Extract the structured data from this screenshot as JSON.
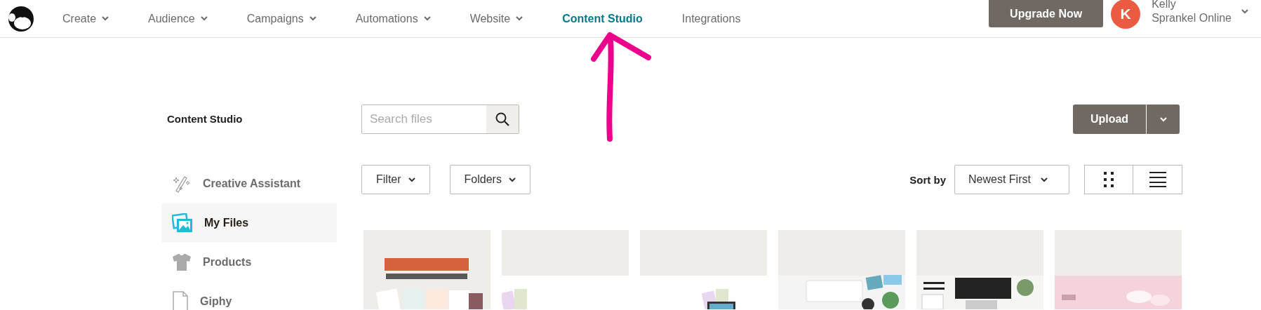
{
  "nav": {
    "items": [
      {
        "label": "Create",
        "has_menu": true,
        "selected": false
      },
      {
        "label": "Audience",
        "has_menu": true,
        "selected": false
      },
      {
        "label": "Campaigns",
        "has_menu": true,
        "selected": false
      },
      {
        "label": "Automations",
        "has_menu": true,
        "selected": false
      },
      {
        "label": "Website",
        "has_menu": true,
        "selected": false
      },
      {
        "label": "Content Studio",
        "has_menu": false,
        "selected": true
      },
      {
        "label": "Integrations",
        "has_menu": false,
        "selected": false
      }
    ],
    "upgrade_button": "Upgrade Now",
    "account": {
      "initial": "K",
      "name": [
        "Kelly",
        "Sprankel Online"
      ]
    }
  },
  "sidebar": {
    "title": "Content Studio",
    "items": [
      {
        "label": "Creative Assistant",
        "selected": false
      },
      {
        "label": "My Files",
        "selected": true
      },
      {
        "label": "Products",
        "selected": false
      },
      {
        "label": "Giphy",
        "selected": false
      }
    ]
  },
  "toolbar": {
    "search": {
      "placeholder": "Search files"
    },
    "upload_button": "Upload",
    "filters": [
      "Filter",
      "Folders"
    ],
    "sort_label": "Sort by",
    "sort_value": "Newest First"
  }
}
